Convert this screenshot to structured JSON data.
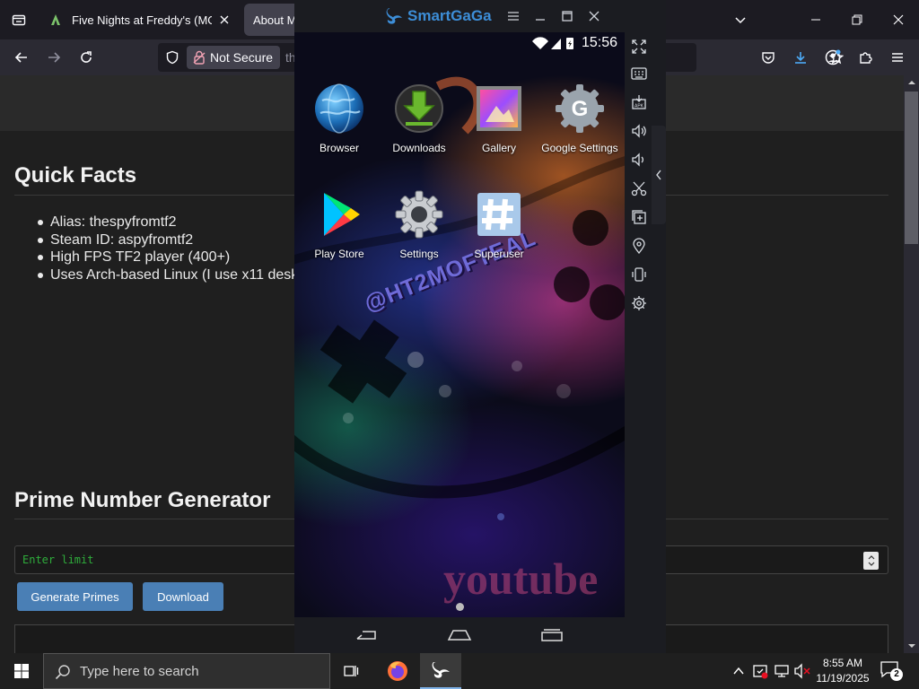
{
  "browser": {
    "tabs": [
      {
        "title": "Five Nights at Freddy's (MOD, U"
      },
      {
        "title": "About Me"
      }
    ],
    "url": {
      "security_label": "Not Secure",
      "text": "th"
    }
  },
  "page": {
    "quick_facts": {
      "heading": "Quick Facts",
      "items": [
        "Alias: thespyfromtf2",
        "Steam ID: aspyfromtf2",
        "High FPS TF2 player (400+)",
        "Uses Arch-based Linux (I use x11 desk"
      ]
    },
    "prime_generator": {
      "heading": "Prime Number Generator",
      "limit_placeholder": "Enter limit",
      "generate_label": "Generate Primes",
      "download_label": "Download"
    }
  },
  "emulator": {
    "app_name": "SmartGaGa",
    "status_time": "15:56",
    "apps": [
      {
        "label": "Browser",
        "icon": "globe-icon"
      },
      {
        "label": "Downloads",
        "icon": "download-icon"
      },
      {
        "label": "Gallery",
        "icon": "gallery-icon"
      },
      {
        "label": "Google Settings",
        "icon": "google-settings-icon"
      },
      {
        "label": "Play Store",
        "icon": "play-store-icon"
      },
      {
        "label": "Settings",
        "icon": "settings-icon"
      },
      {
        "label": "Superuser",
        "icon": "superuser-icon"
      }
    ],
    "wallpaper_text": {
      "tag": "@HT2MOFTEAL",
      "brand": "youtube"
    }
  },
  "taskbar": {
    "search_placeholder": "Type here to search",
    "time": "8:55 AM",
    "date": "11/19/2025",
    "notification_count": "2"
  },
  "colors": {
    "button_blue": "#4a7fb5",
    "input_text_green": "#2fae3c",
    "emulator_brand": "#3d8ed8"
  }
}
